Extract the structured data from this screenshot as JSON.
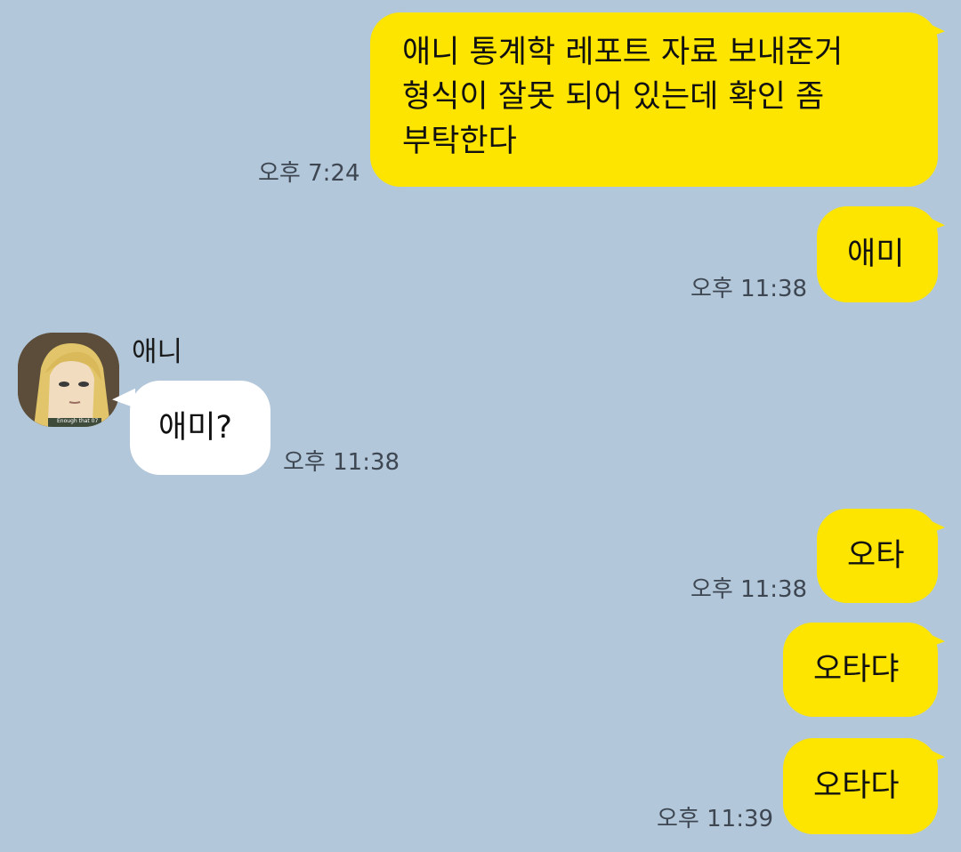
{
  "chat": {
    "messages": [
      {
        "from": "me",
        "text": "애니 통계학 레포트 자료 보내준거\n형식이 잘못 되어 있는데 확인 좀\n부탁한다",
        "time": "오후 7:24"
      },
      {
        "from": "me",
        "text": "애미",
        "time": "오후 11:38"
      },
      {
        "from": "other",
        "sender": "애니",
        "text": "애미?",
        "time": "오후 11:38"
      },
      {
        "from": "me",
        "text": "오타",
        "time": "오후 11:38"
      },
      {
        "from": "me",
        "text": "오타댜",
        "time": ""
      },
      {
        "from": "me",
        "text": "오타다",
        "time": "오후 11:39"
      }
    ],
    "avatar_caption": "Enough that 07"
  },
  "colors": {
    "background": "#b2c7da",
    "my_bubble": "#fee500",
    "their_bubble": "#ffffff",
    "time_text": "#3d4651"
  }
}
